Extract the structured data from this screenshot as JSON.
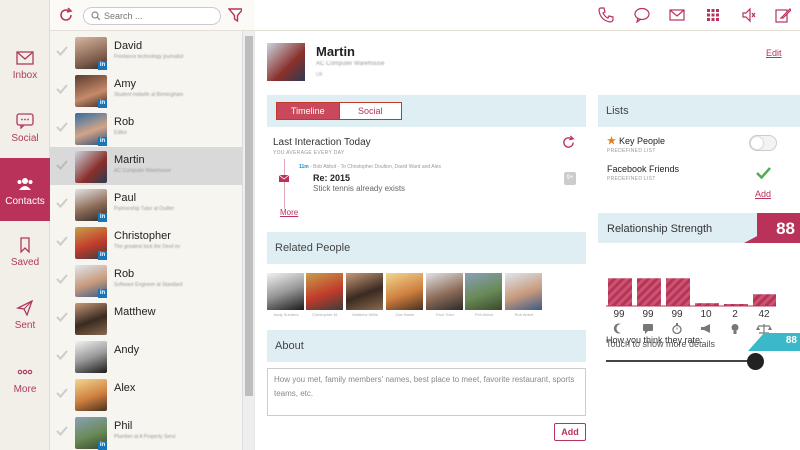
{
  "search": {
    "placeholder": "Search ..."
  },
  "nav": [
    {
      "label": "Inbox",
      "icon": "envelope-icon"
    },
    {
      "label": "Social",
      "icon": "chat-icon"
    },
    {
      "label": "Contacts",
      "icon": "people-icon",
      "active": true
    },
    {
      "label": "Saved",
      "icon": "bookmark-icon"
    },
    {
      "label": "Sent",
      "icon": "paper-plane-icon"
    },
    {
      "label": "More",
      "icon": "dots-icon"
    }
  ],
  "contacts": [
    {
      "name": "David",
      "sub": "Freelance technology journalist",
      "linkedin": true
    },
    {
      "name": "Amy",
      "sub": "Student midwife at Birmingham",
      "linkedin": true
    },
    {
      "name": "Rob",
      "sub": "Editor",
      "linkedin": true
    },
    {
      "name": "Martin",
      "sub": "AC Computer Warehouse",
      "linkedin": false,
      "selected": true
    },
    {
      "name": "Paul",
      "sub": "Partnership Tutor at Ouilter",
      "linkedin": true
    },
    {
      "name": "Christopher",
      "sub": "The greatest trick the Devil ev",
      "linkedin": true
    },
    {
      "name": "Rob",
      "sub": "Software Engineer at Standard",
      "linkedin": true
    },
    {
      "name": "Matthew",
      "sub": "",
      "linkedin": false
    },
    {
      "name": "Andy",
      "sub": "",
      "linkedin": false
    },
    {
      "name": "Alex",
      "sub": "",
      "linkedin": false
    },
    {
      "name": "Phil",
      "sub": "Plumber at A Property Servi",
      "linkedin": true
    }
  ],
  "profile": {
    "name": "Martin",
    "subtitle": "AC Computer Warehouse",
    "subtitle2": "UK",
    "edit_label": "Edit"
  },
  "timeline": {
    "tabs": [
      "Timeline",
      "Social"
    ],
    "last_interaction": "Last Interaction Today",
    "average": "YOU AVERAGE EVERY DAY",
    "entry_meta_time": "11m",
    "entry_meta_text": "- Bob Abbot - To Christopher Doulton, David Ward and Alex",
    "entry_subject": "Re: 2015",
    "entry_text": "Stick tennis already exists",
    "entry_badge": "9+",
    "more_label": "More"
  },
  "related": {
    "title": "Related People",
    "people": [
      {
        "caption": "Andy Sunders"
      },
      {
        "caption": "Christopher M."
      },
      {
        "caption": "Matthew Willis"
      },
      {
        "caption": "Gav Baker"
      },
      {
        "caption": "Paul Tutor"
      },
      {
        "caption": "Phil Abbot"
      },
      {
        "caption": "Rob Abbot"
      }
    ]
  },
  "about": {
    "title": "About",
    "placeholder": "How you met, family members' names, best place to meet, favorite restaurant, sports teams, etc.",
    "add_label": "Add"
  },
  "lists": {
    "title": "Lists",
    "items": [
      {
        "name": "Key People",
        "sub": "PREDEFINED LIST",
        "starred": true,
        "state": "off"
      },
      {
        "name": "Facebook Friends",
        "sub": "PREDEFINED LIST",
        "starred": false,
        "state": "checked"
      }
    ],
    "add_label": "Add"
  },
  "relationship": {
    "title": "Relationship Strength",
    "score": "88",
    "bars": [
      {
        "value": 99,
        "icon": "moon-icon"
      },
      {
        "value": 99,
        "icon": "speech-bubble-icon"
      },
      {
        "value": 99,
        "icon": "stopwatch-icon"
      },
      {
        "value": 10,
        "icon": "megaphone-icon"
      },
      {
        "value": 2,
        "icon": "lightbulb-icon"
      },
      {
        "value": 42,
        "icon": "scales-icon"
      }
    ],
    "touch_text": "Touch to show more details",
    "rate_label": "How you think they rate:",
    "rate_value": "88",
    "rate_fraction": 0.88
  },
  "colors": {
    "accent": "#b8325a",
    "panel": "#dfeef3",
    "bar": "#b8325a"
  }
}
